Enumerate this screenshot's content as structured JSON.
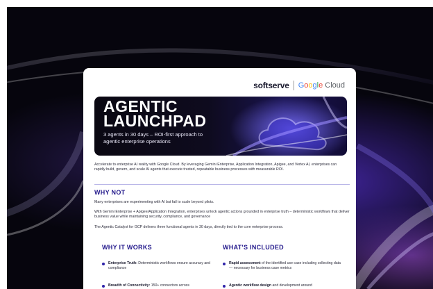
{
  "brand": {
    "softserve": "softserve",
    "google_cloud": "Google Cloud"
  },
  "hero": {
    "title": "AGENTIC LAUNCHPAD",
    "subtitle": "3 agents in 30 days – ROI-first approach to agentic enterprise operations"
  },
  "intro": "Accelerate to enterprise AI reality with Google Cloud. By leveraging Gemini Enterprise, Application Integration, Apigee, and Vertex AI, enterprises can rapidly build, govern, and scale AI agents that execute trusted, repeatable business processes with measurable ROI.",
  "why_not": {
    "heading": "WHY NOT",
    "paragraphs": [
      "Many enterprises are experimenting with AI but fail to scale beyond pilots.",
      "With Gemini Enterprise + Apigee/Application Integration, enterprises unlock agentic actions grounded in enterprise truth – deterministic workflows that deliver business value while maintaining security, compliance, and governance",
      "The Agentic Catalyst for GCP delivers three functional agents in 30 days, directly tied to the core enterprise process."
    ]
  },
  "why_it_works": {
    "heading": "WHY IT WORKS",
    "items": [
      {
        "bold": "Enterprise Truth:",
        "text": " Deterministic workflows ensure accuracy and compliance"
      },
      {
        "bold": "Breadth of Connectivity:",
        "text": " 150+ connectors across"
      }
    ]
  },
  "whats_included": {
    "heading": "WHAT'S INCLUDED",
    "items": [
      {
        "bold": "Rapid assessment",
        "text": " of the identified use case including collecting data — necessary for business case metrics"
      },
      {
        "bold": "Agentic workflow design",
        "text": " and development around"
      }
    ]
  },
  "colors": {
    "heading": "#241a8c",
    "bullet": "#2d22a8",
    "rule": "#b9b6e8",
    "backdrop": "#06050d"
  }
}
